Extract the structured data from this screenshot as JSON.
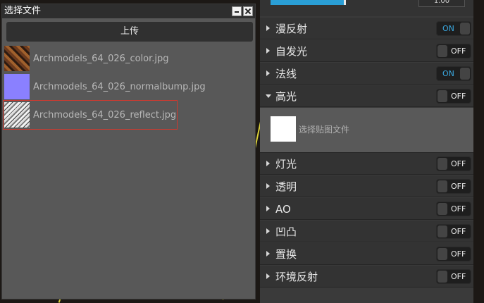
{
  "dialog": {
    "title": "选择文件",
    "upload_label": "上传",
    "files": [
      {
        "name": "Archmodels_64_026_color.jpg",
        "thumb": "color-texture-thumbnail",
        "selected": false
      },
      {
        "name": "Archmodels_64_026_normalbump.jpg",
        "thumb": "normal-map-thumbnail",
        "selected": false
      },
      {
        "name": "Archmodels_64_026_reflect.jpg",
        "thumb": "reflect-map-thumbnail",
        "selected": true
      }
    ]
  },
  "panel": {
    "slider_value": "1.00",
    "rows": [
      {
        "label": "漫反射",
        "state": "ON",
        "expanded": false
      },
      {
        "label": "自发光",
        "state": "OFF",
        "expanded": false
      },
      {
        "label": "法线",
        "state": "ON",
        "expanded": false
      },
      {
        "label": "高光",
        "state": "OFF",
        "expanded": true
      },
      {
        "label": "灯光",
        "state": "OFF",
        "expanded": false
      },
      {
        "label": "透明",
        "state": "OFF",
        "expanded": false
      },
      {
        "label": "AO",
        "state": "OFF",
        "expanded": false
      },
      {
        "label": "凹凸",
        "state": "OFF",
        "expanded": false
      },
      {
        "label": "置换",
        "state": "OFF",
        "expanded": false
      },
      {
        "label": "环境反射",
        "state": "OFF",
        "expanded": false
      }
    ],
    "specular_texture_hint": "选择贴图文件"
  },
  "colors": {
    "accent": "#2a9fd6",
    "selection_border": "#d0392f"
  }
}
